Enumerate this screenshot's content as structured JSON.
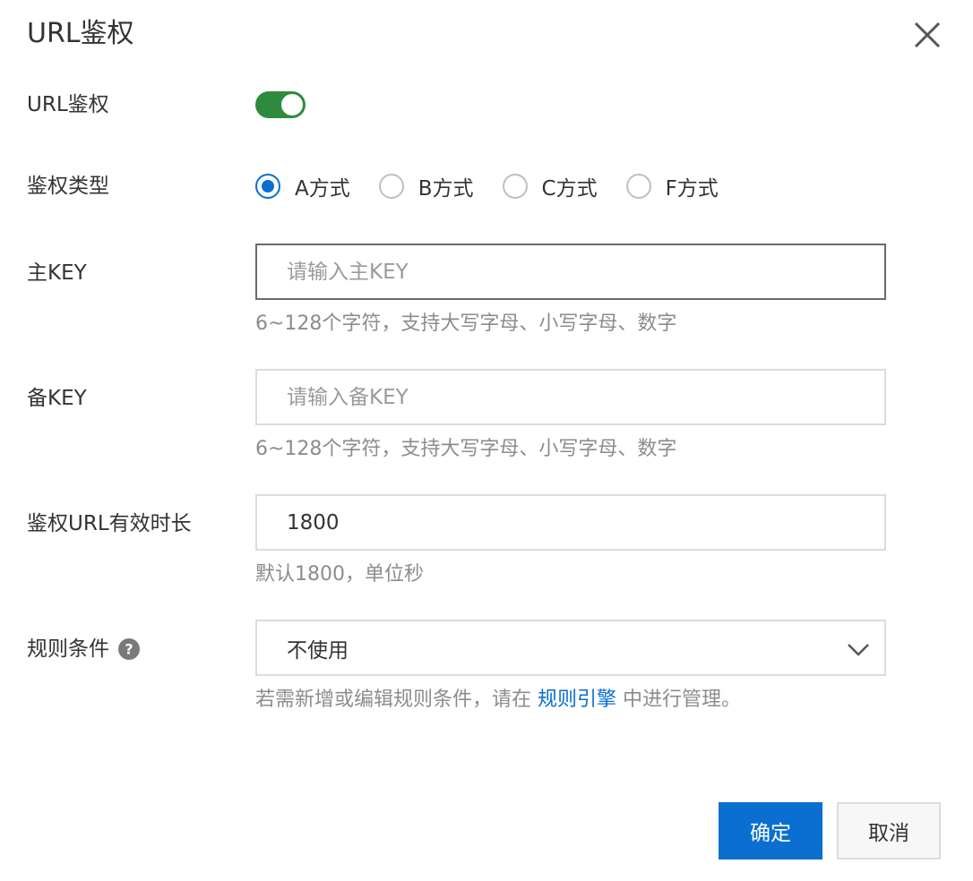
{
  "dialog": {
    "title": "URL鉴权"
  },
  "fields": {
    "url_auth": {
      "label": "URL鉴权",
      "enabled": true
    },
    "auth_type": {
      "label": "鉴权类型",
      "options": [
        "A方式",
        "B方式",
        "C方式",
        "F方式"
      ],
      "selected": "A方式"
    },
    "primary_key": {
      "label": "主KEY",
      "placeholder": "请输入主KEY",
      "value": "",
      "hint": "6~128个字符，支持大写字母、小写字母、数字"
    },
    "backup_key": {
      "label": "备KEY",
      "placeholder": "请输入备KEY",
      "value": "",
      "hint": "6~128个字符，支持大写字母、小写字母、数字"
    },
    "validity": {
      "label": "鉴权URL有效时长",
      "value": "1800",
      "hint": "默认1800，单位秒"
    },
    "rule_condition": {
      "label": "规则条件",
      "value": "不使用",
      "hint_before": "若需新增或编辑规则条件，请在 ",
      "hint_link": "规则引擎",
      "hint_after": " 中进行管理。"
    }
  },
  "buttons": {
    "confirm": "确定",
    "cancel": "取消"
  },
  "colors": {
    "primary": "#0a6fd0",
    "toggle_on": "#2e8b3d",
    "hint_text": "#8c8c8c"
  },
  "icons": {
    "close": "close-icon",
    "help": "help-icon",
    "chevron": "chevron-down-icon"
  }
}
